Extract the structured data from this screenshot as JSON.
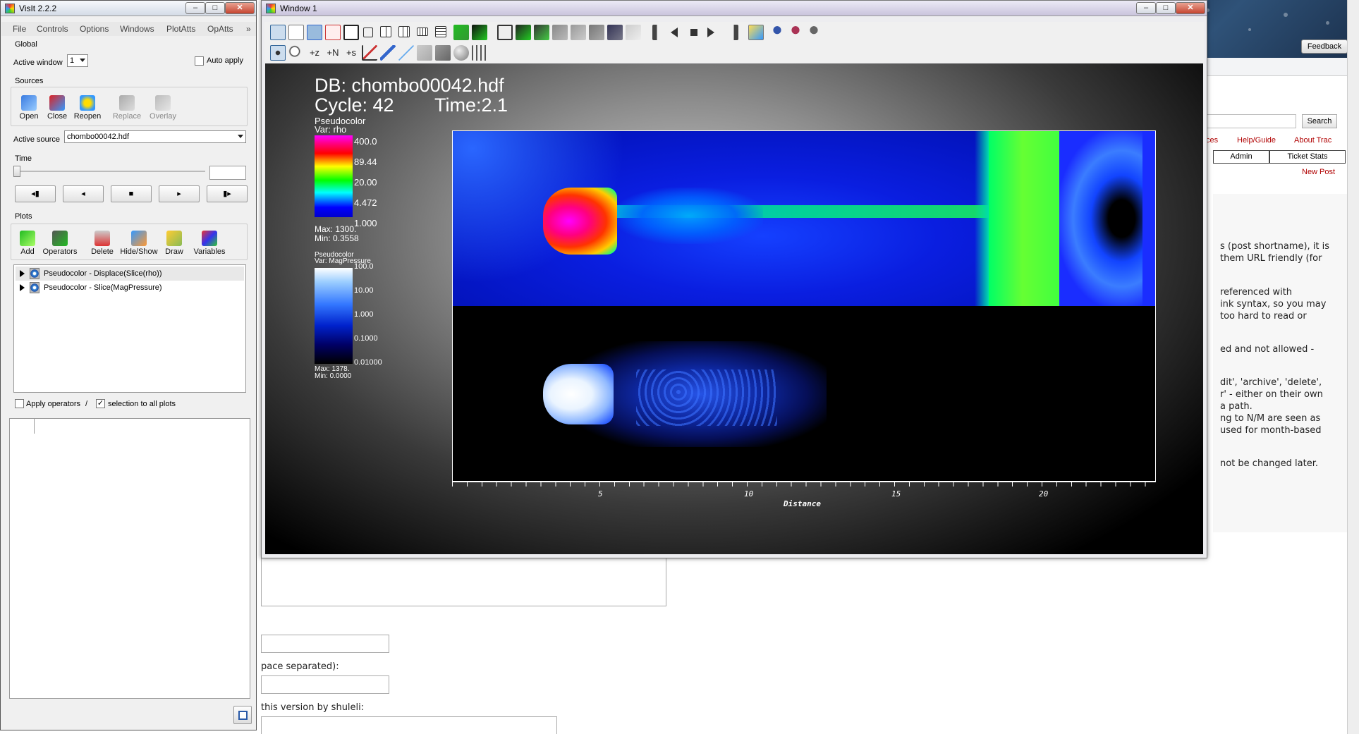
{
  "visit": {
    "title": "VisIt 2.2.2",
    "menu": [
      "File",
      "Controls",
      "Options",
      "Windows",
      "PlotAtts",
      "OpAtts",
      "»"
    ],
    "global_label": "Global",
    "active_window_label": "Active window",
    "active_window_value": "1",
    "auto_apply_label": "Auto apply",
    "sources_label": "Sources",
    "source_tools": [
      "Open",
      "Close",
      "Reopen",
      "Replace",
      "Overlay"
    ],
    "active_source_label": "Active source",
    "active_source_value": "chombo00042.hdf",
    "time_label": "Time",
    "vcr_glyphs": [
      "◂▮",
      "◂",
      "■",
      "▸",
      "▮▸"
    ],
    "plots_label": "Plots",
    "plot_tools": [
      "Add",
      "Operators",
      "Delete",
      "Hide/Show",
      "Draw",
      "Variables"
    ],
    "plots": [
      {
        "label": "Pseudocolor - Displace(Slice(rho))"
      },
      {
        "label": "Pseudocolor - Slice(MagPressure)"
      }
    ],
    "apply_operators_label": "Apply operators",
    "apply_operators_sep": "/",
    "selection_label": "selection to all plots"
  },
  "window1": {
    "title": "Window 1",
    "db_line": "DB: chombo00042.hdf",
    "cycle_line": "Cycle: 42",
    "time_line": "Time:2.1",
    "legend1": {
      "plot": "Pseudocolor",
      "var": "Var: rho",
      "ticks": [
        "400.0",
        "89.44",
        "20.00",
        "4.472",
        "1.000"
      ],
      "max": "Max:  1300.",
      "min": "Min:  0.3558"
    },
    "legend2": {
      "plot": "Pseudocolor",
      "var": "Var: MagPressure",
      "ticks": [
        "100.0",
        "10.00",
        "1.000",
        "0.1000",
        "0.01000"
      ],
      "max": "Max:  1378.",
      "min": "Min:  0.0000"
    },
    "axis": {
      "xlabel": "Distance",
      "ticks": [
        "5",
        "10",
        "15",
        "20"
      ]
    }
  },
  "browser": {
    "feedback": "Feedback",
    "search": "Search",
    "links": [
      "ces",
      "Help/Guide",
      "About Trac"
    ],
    "tabs": [
      "Admin",
      "Ticket Stats"
    ],
    "new_post": "New Post",
    "lines": [
      "s (post shortname), it is",
      "them URL friendly (for",
      "referenced with",
      "ink syntax, so you may",
      " too hard to read or",
      "ed and not allowed -",
      "dit', 'archive', 'delete',",
      "r' - either on their own",
      "a path.",
      "ng to N/M are seen as",
      "used for month-based",
      "not be changed later."
    ],
    "lower_texts": [
      "pace separated):",
      "this version by shuleli:"
    ]
  },
  "colors": {
    "rho_colormap": [
      "#ff00ff",
      "#ff0000",
      "#ffff00",
      "#00ff00",
      "#00ffff",
      "#0000ff",
      "#0000cc"
    ],
    "mag_colormap": [
      "#ffffff",
      "#66aaff",
      "#0033dd",
      "#000066",
      "#000000"
    ]
  }
}
